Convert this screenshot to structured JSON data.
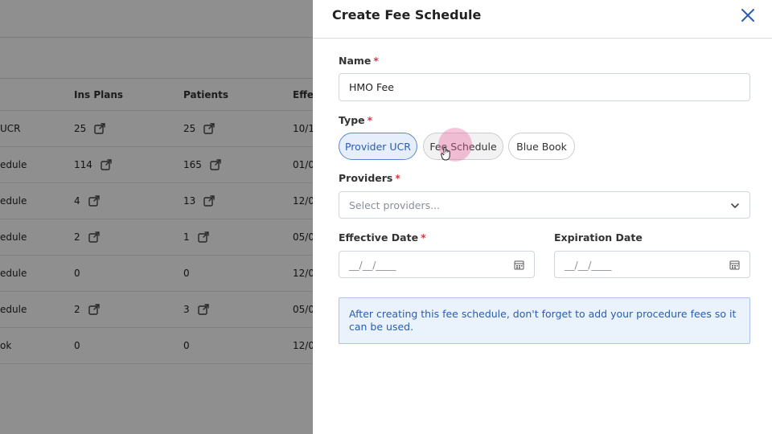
{
  "background": {
    "table": {
      "headers": {
        "ins_plans": "Ins Plans",
        "patients": "Patients",
        "effective": "Effe"
      },
      "rows": [
        {
          "name": " UCR",
          "ins_plans": "25",
          "ins_link": true,
          "patients": "25",
          "pat_link": true,
          "effective": "10/1"
        },
        {
          "name": "edule",
          "ins_plans": "114",
          "ins_link": true,
          "patients": "165",
          "pat_link": true,
          "effective": "01/0"
        },
        {
          "name": "edule",
          "ins_plans": "4",
          "ins_link": true,
          "patients": "13",
          "pat_link": true,
          "effective": "12/0"
        },
        {
          "name": "edule",
          "ins_plans": "2",
          "ins_link": true,
          "patients": "1",
          "pat_link": true,
          "effective": "05/0"
        },
        {
          "name": "edule",
          "ins_plans": "0",
          "ins_link": false,
          "patients": "0",
          "pat_link": false,
          "effective": "12/0"
        },
        {
          "name": "edule",
          "ins_plans": "2",
          "ins_link": true,
          "patients": "3",
          "pat_link": true,
          "effective": "05/0"
        },
        {
          "name": "ok",
          "ins_plans": "0",
          "ins_link": false,
          "patients": "0",
          "pat_link": false,
          "effective": "12/0"
        }
      ]
    }
  },
  "drawer": {
    "title": "Create Fee Schedule",
    "close_icon": "close-icon",
    "name": {
      "label": "Name",
      "required_mark": "*",
      "value": "HMO Fee"
    },
    "type": {
      "label": "Type",
      "required_mark": "*",
      "options": [
        "Provider UCR",
        "Fee Schedule",
        "Blue Book"
      ],
      "selected": "Provider UCR"
    },
    "providers": {
      "label": "Providers",
      "required_mark": "*",
      "placeholder": "Select providers..."
    },
    "effective_date": {
      "label": "Effective Date",
      "required_mark": "*",
      "placeholder": "__/__/____"
    },
    "expiration_date": {
      "label": "Expiration Date",
      "placeholder": "__/__/____"
    },
    "info_message": "After creating this fee schedule, don't forget to add your procedure fees so it can be used."
  },
  "colors": {
    "accent": "#2a5db0",
    "required": "#d23a4a",
    "info_bg": "#eaf2fc",
    "overlay": "rgba(0,0,0,0.44)"
  }
}
